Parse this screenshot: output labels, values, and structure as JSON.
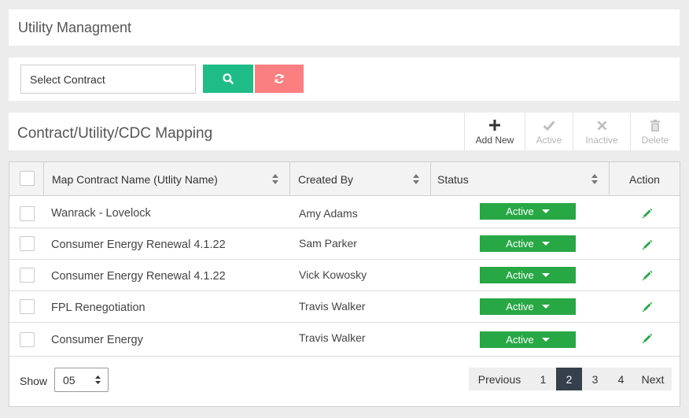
{
  "page": {
    "title": "Utility Managment"
  },
  "filter": {
    "select_value": "Select  Contract",
    "search_icon": "search-icon",
    "reset_icon": "refresh-icon",
    "colors": {
      "search": "#1fbc87",
      "reset": "#fb7e80"
    }
  },
  "mapping": {
    "title": "Contract/Utility/CDC Mapping",
    "toolbar": {
      "add_new": {
        "label": "Add New",
        "icon": "plus-icon",
        "enabled": true
      },
      "active": {
        "label": "Active",
        "icon": "check-icon",
        "enabled": false
      },
      "inactive": {
        "label": "Inactive",
        "icon": "close-icon",
        "enabled": false
      },
      "delete": {
        "label": "Delete",
        "icon": "trash-icon",
        "enabled": false
      }
    }
  },
  "table": {
    "columns": {
      "name": "Map Contract Name (Utlity Name)",
      "created_by": "Created By",
      "status": "Status",
      "action": "Action"
    },
    "rows": [
      {
        "name": "Wanrack - Lovelock",
        "created_by": "Amy Adams",
        "status": "Active"
      },
      {
        "name": "Consumer Energy Renewal 4.1.22",
        "created_by": "Sam Parker",
        "status": "Active"
      },
      {
        "name": "Consumer Energy Renewal 4.1.22",
        "created_by": "Vick Kowosky",
        "status": "Active"
      },
      {
        "name": "FPL Renegotiation",
        "created_by": "Travis Walker",
        "status": "Active"
      },
      {
        "name": "Consumer Energy",
        "created_by": "Travis Walker",
        "status": "Active"
      }
    ],
    "status_color": "#28a745",
    "edit_icon_color": "#28a745"
  },
  "pagination": {
    "show_label": "Show",
    "page_size": "05",
    "previous": "Previous",
    "pages": [
      "1",
      "2",
      "3",
      "4"
    ],
    "current_page": "2",
    "next": "Next"
  }
}
